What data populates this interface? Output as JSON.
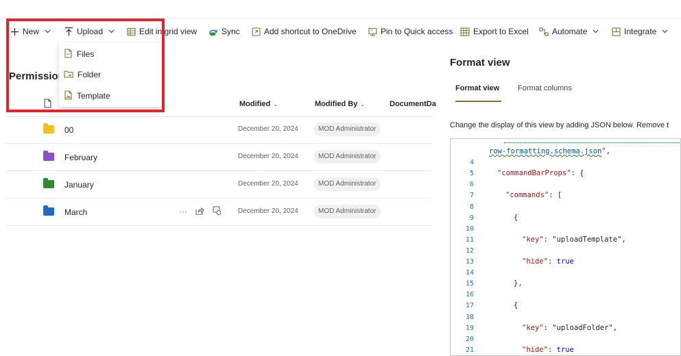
{
  "commandbar": {
    "new": "New",
    "upload": "Upload",
    "edit_grid": "Edit in grid view",
    "sync": "Sync",
    "add_shortcut": "Add shortcut to OneDrive",
    "pin_quick": "Pin to Quick access",
    "export_excel": "Export to Excel",
    "automate": "Automate",
    "integrate": "Integrate"
  },
  "upload_menu": {
    "items": [
      {
        "label": "Files",
        "icon": "file-icon"
      },
      {
        "label": "Folder",
        "icon": "folder-outline-icon"
      },
      {
        "label": "Template",
        "icon": "template-icon"
      }
    ]
  },
  "page": {
    "title": "Permission"
  },
  "list": {
    "columns": {
      "modified": "Modified",
      "modified_by": "Modified By",
      "document": "DocumentDa"
    },
    "rows": [
      {
        "name": "00",
        "modified": "December 20, 2024",
        "modified_by": "MOD Administrator",
        "folder_color": "#f3c21a"
      },
      {
        "name": "February",
        "modified": "December 20, 2024",
        "modified_by": "MOD Administrator",
        "folder_color": "#8a4fc9"
      },
      {
        "name": "January",
        "modified": "December 20, 2024",
        "modified_by": "MOD Administrator",
        "folder_color": "#2e8b33"
      },
      {
        "name": "March",
        "modified": "December 20, 2024",
        "modified_by": "MOD Administrator",
        "folder_color": "#1c6cc8"
      }
    ],
    "row_actions_glyph": "···"
  },
  "panel": {
    "title": "Format view",
    "tabs": [
      "Format view",
      "Format columns"
    ],
    "description": "Change the display of this view by adding JSON below. Remove t",
    "code_lines": [
      {
        "n": "",
        "text": "row-formatting.schema.json\","
      },
      {
        "n": "4",
        "text": ""
      },
      {
        "n": "5",
        "text": "\"commandBarProps\": {"
      },
      {
        "n": "6",
        "text": ""
      },
      {
        "n": "7",
        "text": "\"commands\": ["
      },
      {
        "n": "8",
        "text": ""
      },
      {
        "n": "9",
        "text": "{"
      },
      {
        "n": "10",
        "text": ""
      },
      {
        "n": "11",
        "text": "\"key\": \"uploadTemplate\","
      },
      {
        "n": "12",
        "text": ""
      },
      {
        "n": "13",
        "text": "\"hide\": true"
      },
      {
        "n": "14",
        "text": ""
      },
      {
        "n": "15",
        "text": "},"
      },
      {
        "n": "16",
        "text": ""
      },
      {
        "n": "17",
        "text": "{"
      },
      {
        "n": "18",
        "text": ""
      },
      {
        "n": "19",
        "text": "\"key\": \"uploadFolder\","
      },
      {
        "n": "20",
        "text": ""
      },
      {
        "n": "21",
        "text": "\"hide\": true"
      }
    ]
  },
  "colors": {
    "highlight": "#e3232d",
    "accent": "#8a6d2e"
  }
}
